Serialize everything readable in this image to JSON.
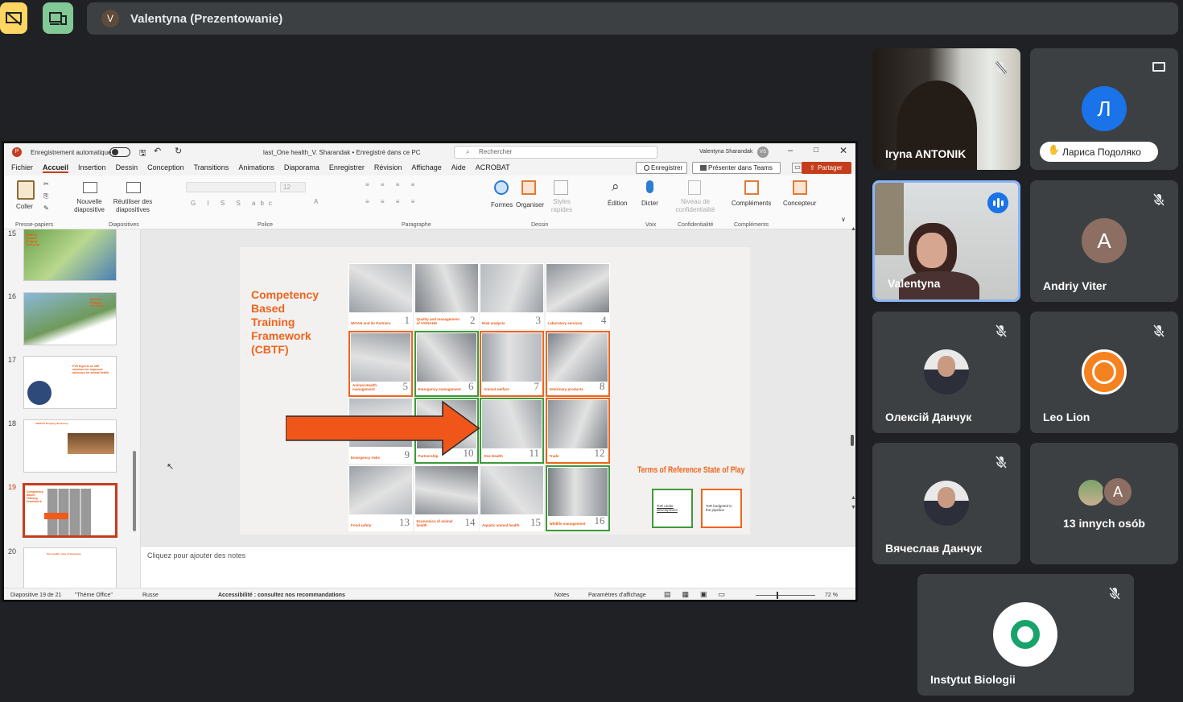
{
  "topbar": {
    "presenter_initial": "V",
    "presenter_label": "Valentyna (Prezentowanie)"
  },
  "ppt": {
    "autosave_label": "Enregistrement automatique",
    "doc_title": "last_One health_V. Sharandak • Enregistré dans ce PC",
    "search_placeholder": "Rechercher",
    "user_name": "Valentyna Sharandak",
    "user_initials": "VS",
    "tabs": [
      "Fichier",
      "Accueil",
      "Insertion",
      "Dessin",
      "Conception",
      "Transitions",
      "Animations",
      "Diaporama",
      "Enregistrer",
      "Révision",
      "Affichage",
      "Aide",
      "ACROBAT"
    ],
    "btn_record": "Enregistrer",
    "btn_teams": "Présenter dans Teams",
    "btn_share": "Partager",
    "ribbon": {
      "coller": "Coller",
      "nouvelle": "Nouvelle diapositive",
      "reutiliser": "Réutiliser des diapositives",
      "formes": "Formes",
      "organiser": "Organiser",
      "styles": "Styles rapides",
      "edition": "Édition",
      "dicter": "Dicter",
      "niveau": "Niveau de confidentialité",
      "complements": "Compléments",
      "concepteur": "Concepteur",
      "font_size": "12",
      "groups": [
        "Presse-papiers",
        "Diapositives",
        "Police",
        "Paragraphe",
        "Dessin",
        "Voix",
        "Confidentialité",
        "Compléments"
      ]
    },
    "thumbnails": [
      {
        "num": "15",
        "title": "EBI/PVS National Bridging Workshop"
      },
      {
        "num": "16",
        "title": "National Bridging Workshop"
      },
      {
        "num": "17",
        "title": "PVS Experts as JEE missions for improved advocacy for animal health"
      },
      {
        "num": "18",
        "title": "IHR/PVS Bridging Workshop"
      },
      {
        "num": "19",
        "title": "Competency Based Training Framework"
      },
      {
        "num": "20",
        "title": "One health; view of Veterinary"
      }
    ],
    "slide": {
      "title_lines": [
        "Competency",
        "Based",
        "Training",
        "Framework",
        "(CBTF)"
      ],
      "tiles": [
        {
          "no": "1",
          "label": "WOAH and its Partners"
        },
        {
          "no": "2",
          "label": "Quality and management of VS/NAHS"
        },
        {
          "no": "3",
          "label": "Risk analysis"
        },
        {
          "no": "4",
          "label": "Laboratory services"
        },
        {
          "no": "5",
          "label": "Animal Health management"
        },
        {
          "no": "6",
          "label": "Emergency management"
        },
        {
          "no": "7",
          "label": "Animal welfare"
        },
        {
          "no": "8",
          "label": "Veterinary products"
        },
        {
          "no": "9",
          "label": "Emergency risks"
        },
        {
          "no": "10",
          "label": "Partnership"
        },
        {
          "no": "11",
          "label": "One Health"
        },
        {
          "no": "12",
          "label": "Trade"
        },
        {
          "no": "13",
          "label": "Food safety"
        },
        {
          "no": "14",
          "label": "Economics of animal health"
        },
        {
          "no": "15",
          "label": "Aquatic animal health"
        },
        {
          "no": "16",
          "label": "Wildlife management"
        }
      ],
      "tor_title": "Terms of Reference State of Play",
      "legend_green": "ToR under development",
      "legend_orange": "ToR budgeted in the pipeline"
    },
    "notes_placeholder": "Cliquez pour ajouter des notes",
    "status": {
      "slide": "Diapositive 19 de 21",
      "theme": "\"Thème Office\"",
      "lang": "Russe",
      "access": "Accessibilité : consultez nos recommandations",
      "notes": "Notes",
      "display": "Paramètres d'affichage",
      "zoom": "72 %"
    }
  },
  "participants": [
    {
      "name": "Iryna ANTONIK",
      "type": "video"
    },
    {
      "name": "Лариса Подоляко",
      "initial": "Л",
      "color": "#1a73e8"
    },
    {
      "name": "Valentyna",
      "type": "video"
    },
    {
      "name": "Andriy Viter",
      "initial": "A",
      "color": "#8d6e63"
    },
    {
      "name": "Олексій Данчук",
      "type": "photo"
    },
    {
      "name": "Leo Lion",
      "type": "photo"
    },
    {
      "name": "Вячеслав Данчук",
      "type": "photo"
    },
    {
      "name": "13 innych osób",
      "initial": "A"
    },
    {
      "name": "Instytut Biologii",
      "type": "logo"
    }
  ]
}
